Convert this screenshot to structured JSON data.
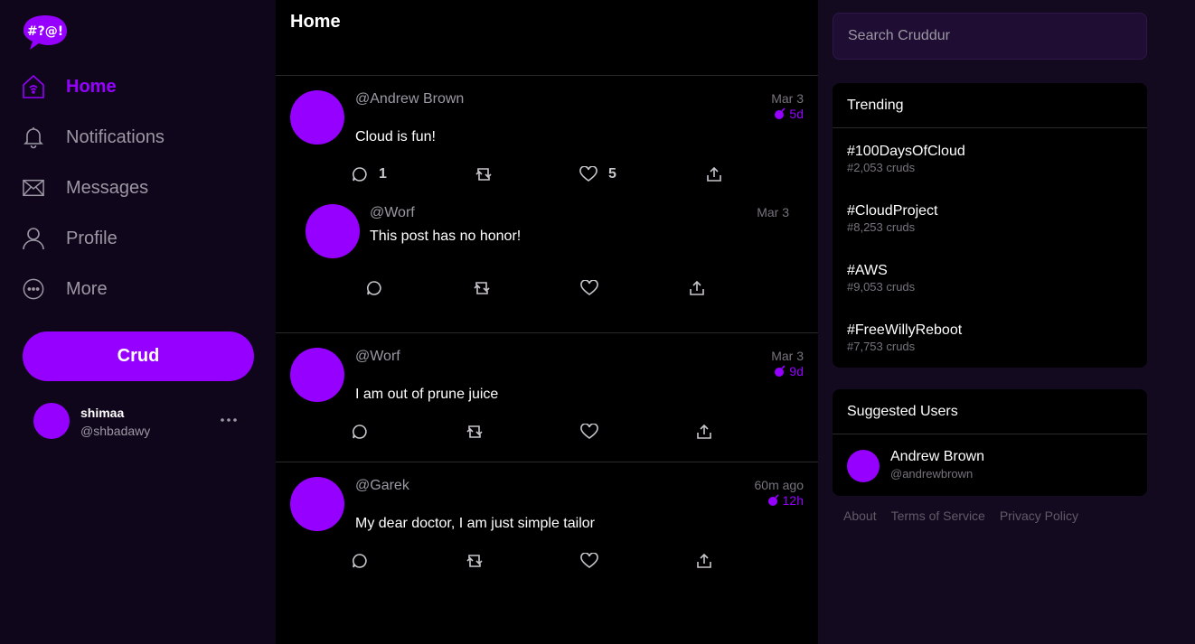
{
  "app": {
    "logo_text": "#?@!"
  },
  "nav": {
    "items": [
      {
        "label": "Home",
        "active": true,
        "icon": "home-icon"
      },
      {
        "label": "Notifications",
        "active": false,
        "icon": "bell-icon"
      },
      {
        "label": "Messages",
        "active": false,
        "icon": "envelope-icon"
      },
      {
        "label": "Profile",
        "active": false,
        "icon": "person-icon"
      },
      {
        "label": "More",
        "active": false,
        "icon": "more-circle-icon"
      }
    ],
    "crud_button": "Crud"
  },
  "current_user": {
    "name": "shimaa",
    "handle": "@shbadawy"
  },
  "feed": {
    "title": "Home",
    "posts": [
      {
        "handle": "@Andrew Brown",
        "date": "Mar 3",
        "ttl": "5d",
        "message": "Cloud is fun!",
        "replies": "1",
        "likes": "5",
        "reply": {
          "handle": "@Worf",
          "date": "Mar 3",
          "message": "This post has no honor!"
        }
      },
      {
        "handle": "@Worf",
        "date": "Mar 3",
        "ttl": "9d",
        "message": "I am out of prune juice"
      },
      {
        "handle": "@Garek",
        "date": "60m ago",
        "ttl": "12h",
        "message": "My dear doctor, I am just simple tailor"
      }
    ]
  },
  "search": {
    "placeholder": "Search Cruddur"
  },
  "trending": {
    "title": "Trending",
    "items": [
      {
        "tag": "#100DaysOfCloud",
        "count": "#2,053 cruds"
      },
      {
        "tag": "#CloudProject",
        "count": "#8,253 cruds"
      },
      {
        "tag": "#AWS",
        "count": "#9,053 cruds"
      },
      {
        "tag": "#FreeWillyReboot",
        "count": "#7,753 cruds"
      }
    ]
  },
  "suggested": {
    "title": "Suggested Users",
    "users": [
      {
        "name": "Andrew Brown",
        "handle": "@andrewbrown"
      }
    ]
  },
  "footer": {
    "links": [
      "About",
      "Terms of Service",
      "Privacy Policy"
    ]
  },
  "colors": {
    "accent": "#9500ff",
    "sidebar_bg": "#10061c",
    "feed_bg": "#000000",
    "right_bg": "#140a20"
  }
}
